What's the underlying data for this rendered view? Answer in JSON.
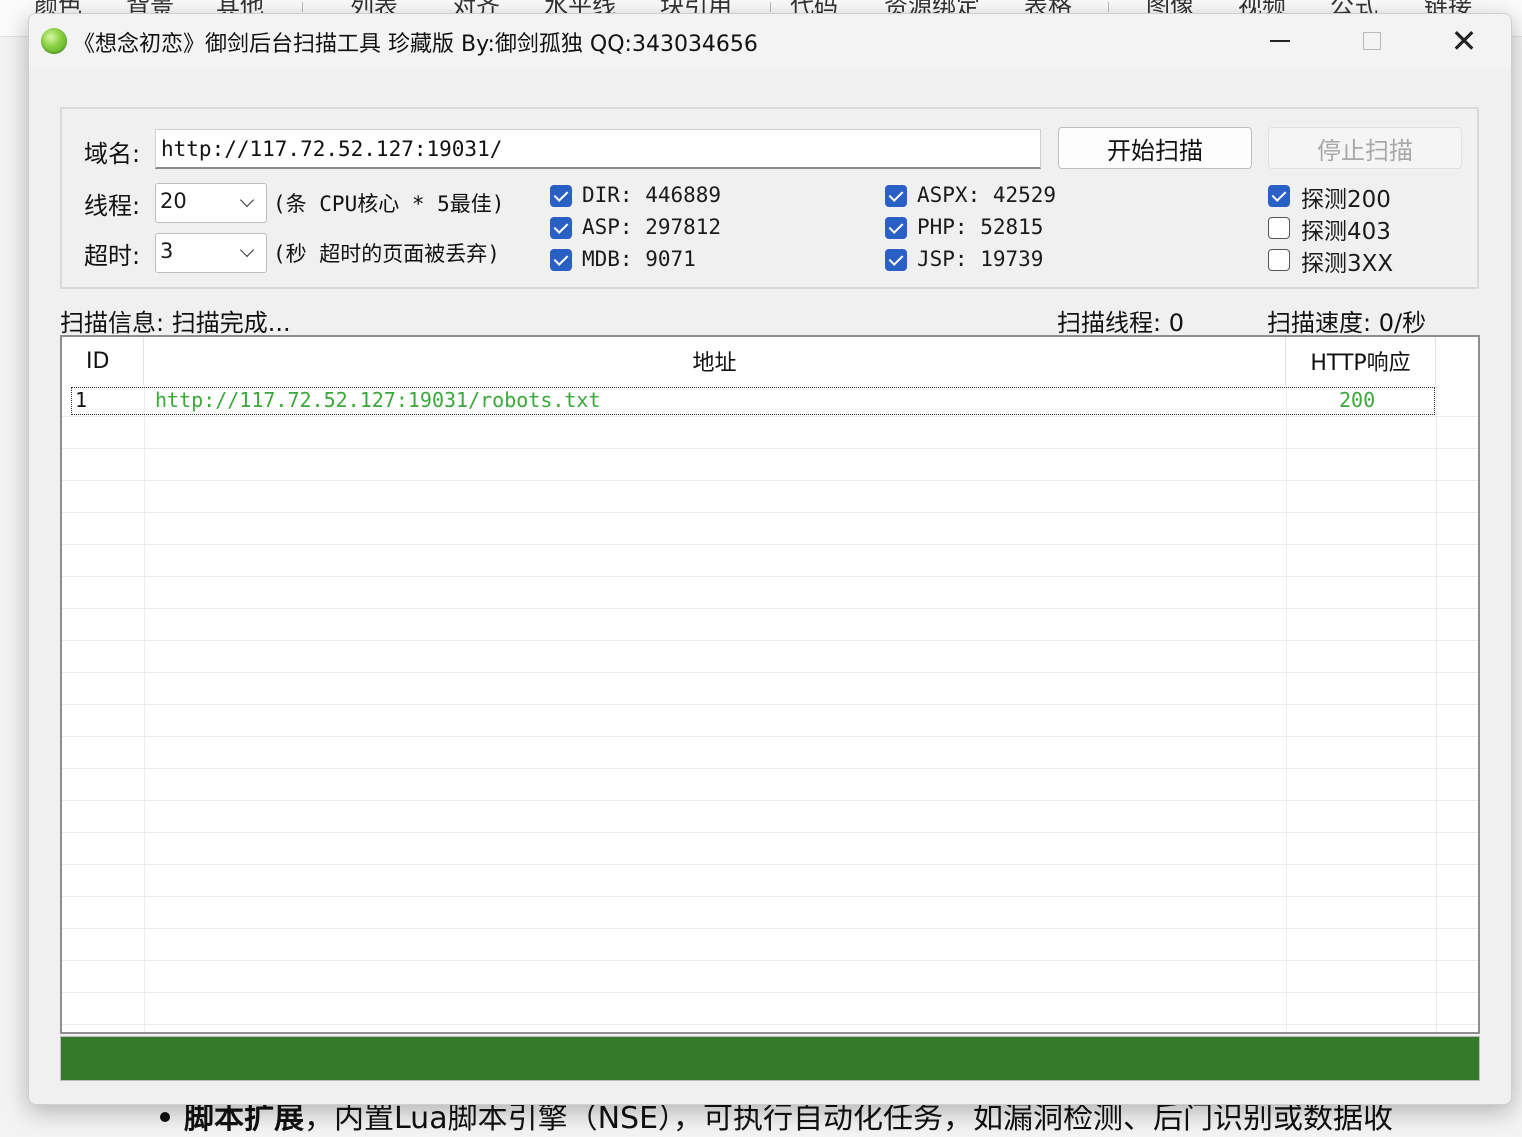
{
  "background_page": {
    "toolbar_tabs": [
      "颜色",
      "背景",
      "其他",
      "列表",
      "对齐",
      "水平线",
      "块引用",
      "代码",
      "资源绑定",
      "表格",
      "图像",
      "视频",
      "公式",
      "链接"
    ],
    "bullet_bold": "脚本扩展",
    "bullet_text": "，内置Lua脚本引擎（NSE），可执行自动化任务，如漏洞检测、后门识别或数据收"
  },
  "window": {
    "title": "《想念初恋》御剑后台扫描工具 珍藏版 By:御剑孤独 QQ:343034656",
    "controls": {
      "minimize": "minimize",
      "maximize": "maximize",
      "close": "✕"
    }
  },
  "options": {
    "domain_label": "域名:",
    "domain_value": "http://117.72.52.127:19031/",
    "start_button": "开始扫描",
    "stop_button": "停止扫描",
    "threads_label": "线程:",
    "threads_value": "20",
    "threads_hint": "(条 CPU核心 * 5最佳)",
    "timeout_label": "超时:",
    "timeout_value": "3",
    "timeout_hint": "(秒 超时的页面被丢弃)",
    "dictionaries": [
      {
        "label": "DIR: 446889",
        "checked": true
      },
      {
        "label": "ASP: 297812",
        "checked": true
      },
      {
        "label": "MDB: 9071",
        "checked": true
      },
      {
        "label": "ASPX: 42529",
        "checked": true
      },
      {
        "label": "PHP: 52815",
        "checked": true
      },
      {
        "label": "JSP: 19739",
        "checked": true
      }
    ],
    "probes": [
      {
        "label": "探测200",
        "checked": true
      },
      {
        "label": "探测403",
        "checked": false
      },
      {
        "label": "探测3XX",
        "checked": false
      }
    ]
  },
  "status": {
    "scan_info": "扫描信息: 扫描完成...",
    "scan_threads": "扫描线程: 0",
    "scan_speed": "扫描速度: 0/秒"
  },
  "results": {
    "columns": [
      "ID",
      "地址",
      "HTTP响应"
    ],
    "rows": [
      {
        "id": "1",
        "url": "http://117.72.52.127:19031/robots.txt",
        "code": "200"
      }
    ]
  },
  "progress": {
    "percent": 100
  },
  "colors": {
    "accent_checkbox": "#2a5fc5",
    "result_text": "#3aa83a",
    "progress_fill": "#357a2b"
  }
}
